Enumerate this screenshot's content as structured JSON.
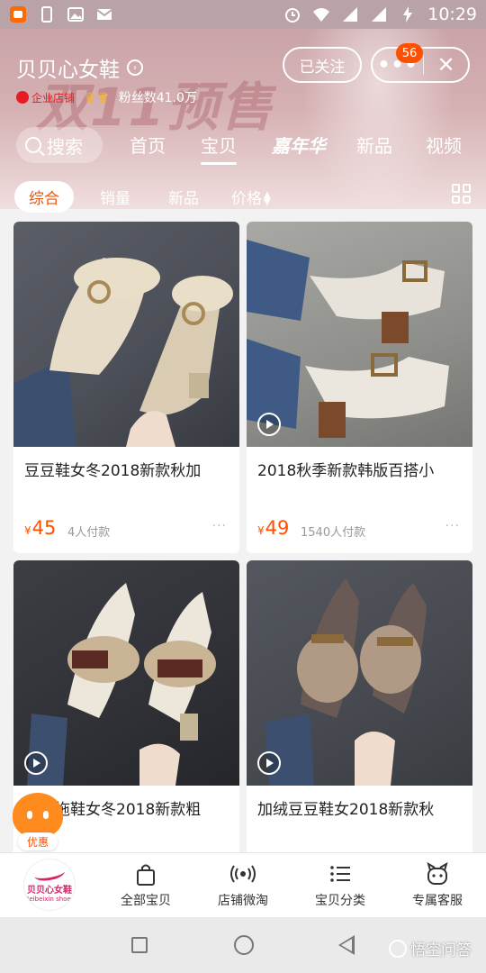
{
  "status_bar": {
    "time": "10:29"
  },
  "shop": {
    "name": "贝贝心女鞋",
    "enterprise_label": "企业店铺",
    "fans": "粉丝数41.0万",
    "follow_label": "已关注",
    "more_badge": "56",
    "banner_text": "双11预售"
  },
  "nav": {
    "search_label": "搜索",
    "tabs": [
      "首页",
      "宝贝",
      "嘉年华",
      "新品",
      "视频"
    ]
  },
  "sort": {
    "items": [
      "综合",
      "销量",
      "新品",
      "价格"
    ]
  },
  "products": [
    {
      "title": "豆豆鞋女冬2018新款秋加",
      "price": "45",
      "sold": "4人付款"
    },
    {
      "title": "2018秋季新款韩版百搭小",
      "price": "49",
      "sold": "1540人付款"
    },
    {
      "title": "毛毛拖鞋女冬2018新款粗",
      "price": "",
      "sold": ""
    },
    {
      "title": "加绒豆豆鞋女2018新款秋",
      "price": "",
      "sold": ""
    }
  ],
  "currency_symbol": "¥",
  "coupon_label": "优惠",
  "tabbar": {
    "logo_text": "贝贝心女鞋",
    "logo_sub": "Beibeixin shoes",
    "items": [
      "全部宝贝",
      "店铺微淘",
      "宝贝分类",
      "专属客服"
    ]
  },
  "watermark": "悟空问答",
  "colors": {
    "accent": "#ff5000",
    "header_bg": "#c9a3a7"
  }
}
